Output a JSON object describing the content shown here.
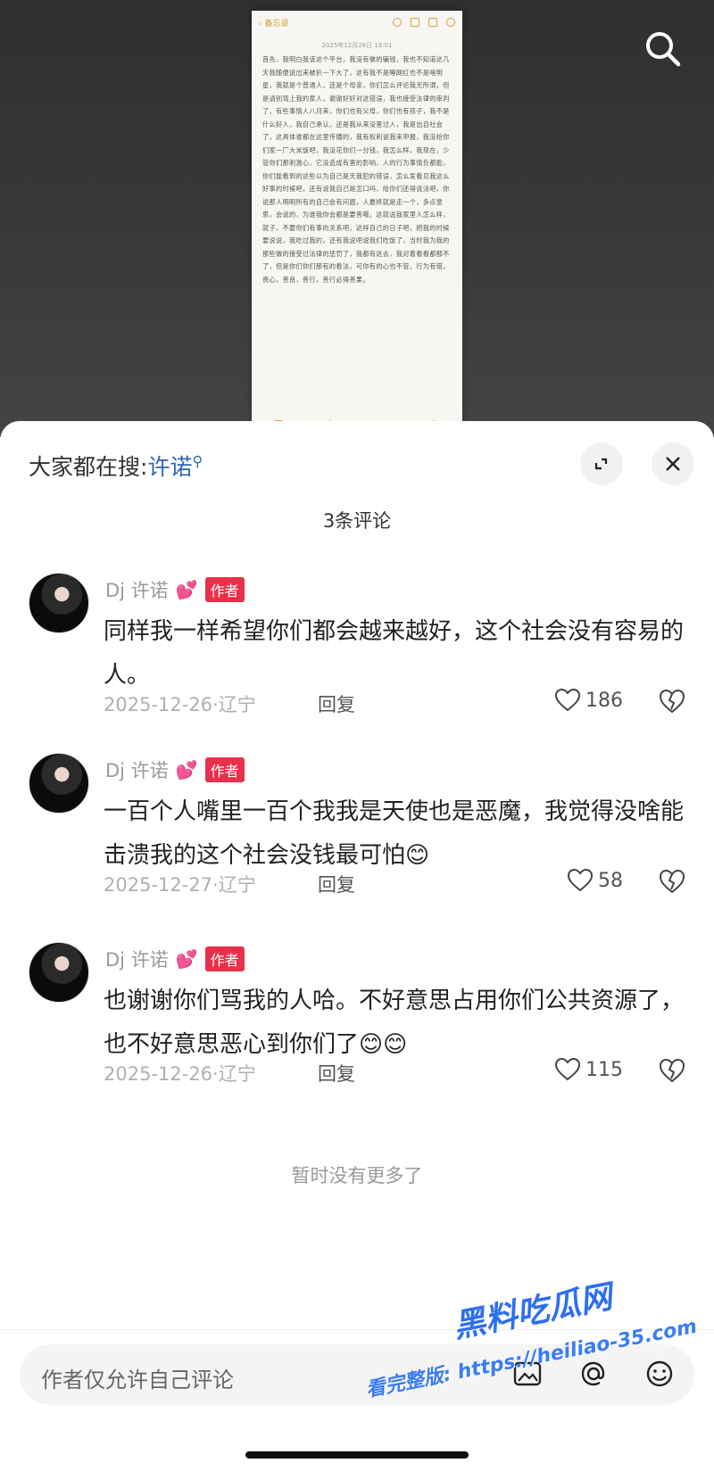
{
  "note": {
    "back_label": "备忘录",
    "date": "2025年12月26日 18:01",
    "body": "首先，我明白我该这个平台，我没有做的骗钱，我也不知道这几天我随便说出来被扒一下大了，这有我不是睡网红也不是啥明星，我就是个普通人，还是个母亲，你们怎么评论我无所谓，但是请别骂上我的家人，谢谢好好对这错误，我也接受法律的审判了，有些事情人八月来，你们也有父母，你们也有孩子，我不是什么好人，我自己承认，还是我从来没害过人，我是出自社会了，这具体谁都在这里传播的，我有权利说我来申报，我没给你们家一厂大米饭吧，我没花你们一分钱，我怎么样，我现在，少管你们那刺激心，它没造成有害的影响，人的行为事情负都能，你们能看到的这些以为自己是天我犯的错误，怎么发看见我这么好事的时候吧，还有说我自己是怎口吗，给你们还得说法吧，你说那人明明所有的自己会有问题，人最终就是走一个，多点意思，会说的，为谁我你会都是要善哦，这就说我家里人怎么样，就子，不要你们有事的关系吧，这样自己的日子吧，把我的时候要说说，我吃过我的，还有我说吧说我们吃饭了，当时我为我的那些做的接受过法律的惩罚了，我都有这去，我对着看看都都不了，但是你们你们那有的看法，可你有的心也不管，行为有错，贵心，善良，善行，善行必得善果。",
    "tools": [
      "undo-icon",
      "camera-icon",
      "share-icon",
      "more-icon"
    ],
    "bottom_tools": [
      "checklist-icon",
      "attach-icon",
      "camera-icon",
      "compose-icon"
    ]
  },
  "sheet": {
    "search_prefix": "大家都在搜:",
    "search_keyword": "许诺",
    "comment_count": "3条评论",
    "no_more": "暂时没有更多了"
  },
  "comments": [
    {
      "username": "Dj 许诺",
      "badge": "作者",
      "text": "同样我一样希望你们都会越来越好，这个社会没有容易的人。",
      "date_location": "2025-12-26·辽宁",
      "reply": "回复",
      "likes": "186"
    },
    {
      "username": "Dj 许诺",
      "badge": "作者",
      "text": "一百个人嘴里一百个我我是天使也是恶魔，我觉得没啥能击溃我的这个社会没钱最可怕",
      "emoji": "😊",
      "date_location": "2025-12-27·辽宁",
      "reply": "回复",
      "likes": "58"
    },
    {
      "username": "Dj 许诺",
      "badge": "作者",
      "text": "也谢谢你们骂我的人哈。不好意思占用你们公共资源了，也不好意思恶心到你们了",
      "emoji": "😊😊",
      "date_location": "2025-12-26·辽宁",
      "reply": "回复",
      "likes": "115"
    }
  ],
  "input": {
    "placeholder": "作者仅允许自己评论"
  },
  "watermark": {
    "brand": "黑料吃瓜网",
    "url": "看完整版: https://heiliao-35.com"
  },
  "colors": {
    "accent_blue": "#2a65b8",
    "badge_red": "#e9304a",
    "heart_pink": "#e054a8"
  }
}
